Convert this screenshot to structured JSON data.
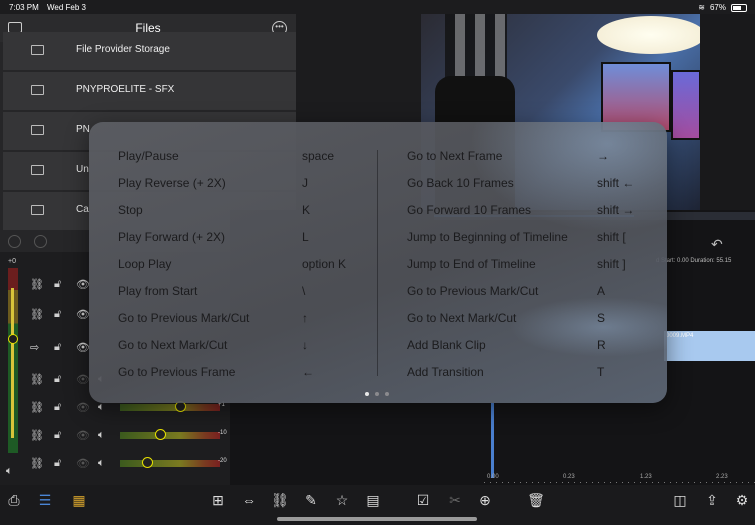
{
  "status_bar": {
    "time": "7:03 PM",
    "date": "Wed Feb 3",
    "battery": "67%",
    "battery_level": 0.67
  },
  "files": {
    "title": "Files",
    "items": [
      {
        "label": "File Provider Storage"
      },
      {
        "label": "PNYPROELITE - SFX"
      },
      {
        "label": "PN"
      },
      {
        "label": "Un"
      },
      {
        "label": "Ca"
      }
    ]
  },
  "timeline": {
    "info": "d Start: 0.00  Duration: 55.15",
    "clip_label": "0009.MP4",
    "ruler": [
      "0.00",
      "0.23",
      "1.23",
      "2.23"
    ]
  },
  "tracks": {
    "top_label": "+0",
    "rows": [
      {
        "gain_label": ""
      },
      {
        "gain_label": ""
      },
      {
        "gain_label": ""
      },
      {
        "gain_label": ""
      },
      {
        "gain_label": "+1"
      },
      {
        "gain_label": "-10"
      },
      {
        "gain_label": "-20"
      }
    ]
  },
  "shortcuts": {
    "left": [
      {
        "action": "Play/Pause",
        "key": "space"
      },
      {
        "action": "Play Reverse (+ 2X)",
        "key": "J"
      },
      {
        "action": "Stop",
        "key": "K"
      },
      {
        "action": "Play Forward (+ 2X)",
        "key": "L"
      },
      {
        "action": "Loop Play",
        "key": "option K"
      },
      {
        "action": "Play from Start",
        "key": "\\"
      },
      {
        "action": "Go to Previous Mark/Cut",
        "key": "↑"
      },
      {
        "action": "Go to Next Mark/Cut",
        "key": "↓"
      },
      {
        "action": "Go to Previous Frame",
        "key": "←"
      }
    ],
    "right": [
      {
        "action": "Go to Next Frame",
        "key": "→"
      },
      {
        "action": "Go Back 10 Frames",
        "key": "shift ←"
      },
      {
        "action": "Go Forward 10 Frames",
        "key": "shift →"
      },
      {
        "action": "Jump to Beginning of Timeline",
        "key": "shift ["
      },
      {
        "action": "Jump to End of Timeline",
        "key": "shift ]"
      },
      {
        "action": "Go to Previous Mark/Cut",
        "key": "A"
      },
      {
        "action": "Go to Next Mark/Cut",
        "key": "S"
      },
      {
        "action": "Add Blank Clip",
        "key": "R"
      },
      {
        "action": "Add Transition",
        "key": "T"
      }
    ],
    "page_count": 3,
    "current_page": 1
  },
  "icons": {
    "toolbar_left": [
      "import-icon",
      "list-view-icon",
      "grid-view-icon"
    ],
    "toolbar_center": [
      "add-clip-icon",
      "split-icon",
      "link-icon",
      "pen-icon",
      "favorite-icon",
      "titles-icon",
      "checkbox-icon",
      "cut-icon",
      "add-icon",
      "trash-icon"
    ],
    "toolbar_right": [
      "layout-icon",
      "share-icon",
      "settings-icon"
    ]
  },
  "colors": {
    "accent": "#3b78c6",
    "meter_knob": "#e7e200",
    "clip": "#a8c9ef"
  }
}
